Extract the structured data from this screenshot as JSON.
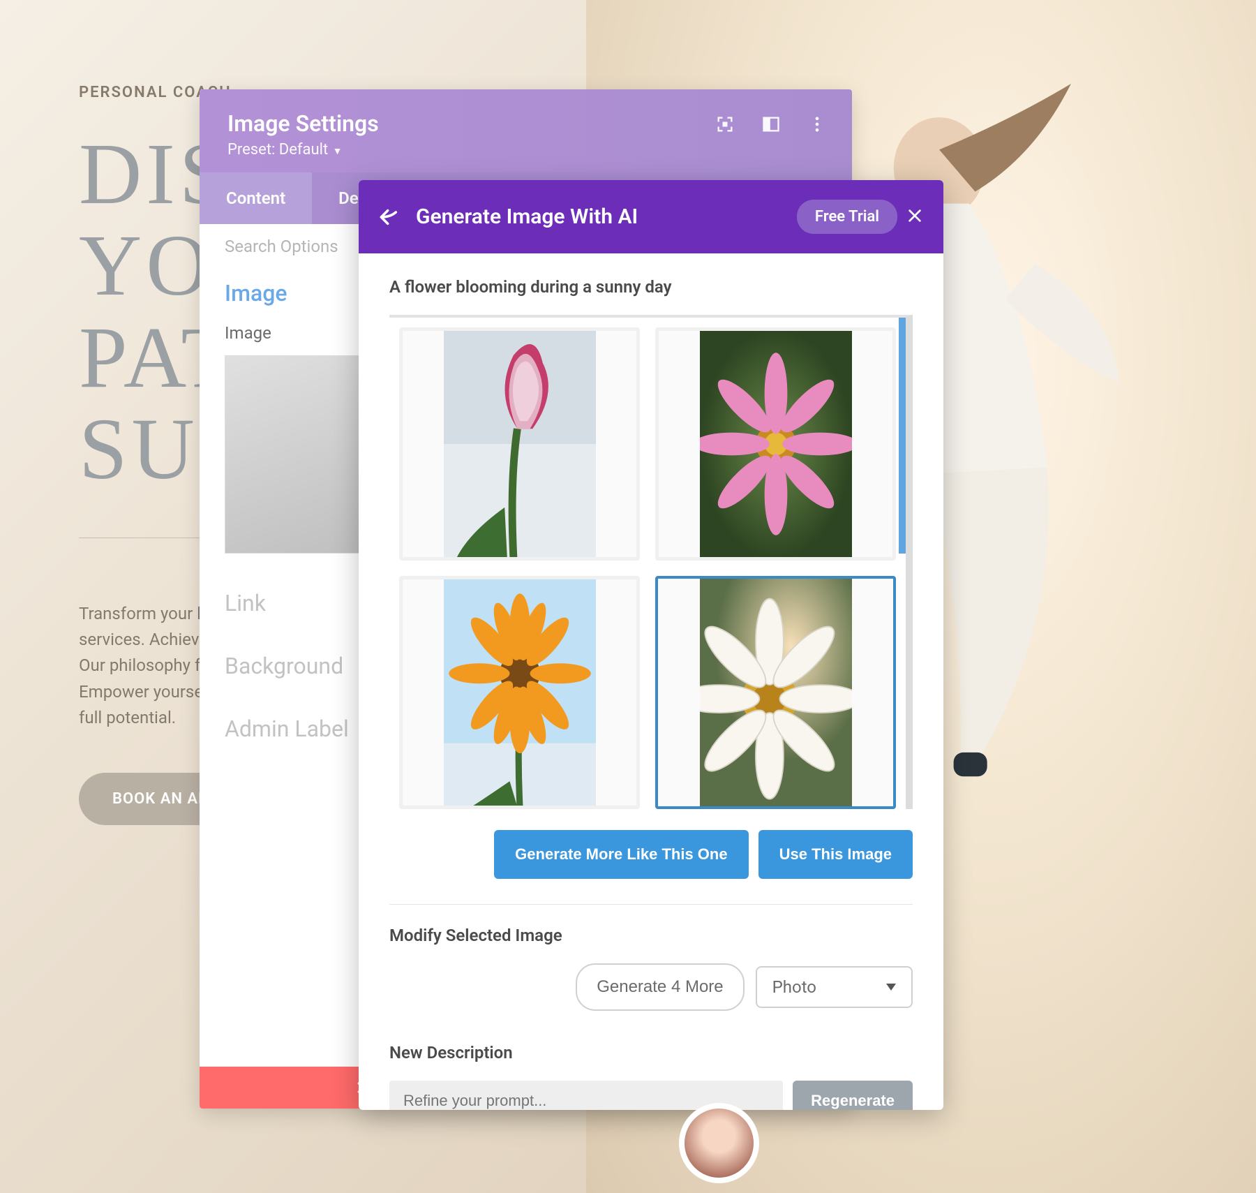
{
  "background": {
    "kicker": "PERSONAL COACH",
    "heading_l1": "DISCOVER",
    "heading_l2": "YOUR PATH TO",
    "heading_l3": "SUCCESS",
    "paragraph": "Transform your life and career with our personalized coaching services. Achieve your goals with a tailored approach that works. Our philosophy focuses on growth, accountability, and life balance. Empower yourself with tools and strategies designed to unlock your full potential.",
    "cta": "BOOK AN APPOINTMENT"
  },
  "settings_panel": {
    "title": "Image Settings",
    "preset_label": "Preset: Default",
    "tabs": [
      "Content",
      "Design"
    ],
    "search_placeholder": "Search Options",
    "section_image": "Image",
    "field_image": "Image",
    "section_link": "Link",
    "section_background": "Background",
    "section_admin": "Admin Label"
  },
  "ai_modal": {
    "title": "Generate Image With AI",
    "trial_label": "Free Trial",
    "prompt": "A flower blooming during a sunny day",
    "btn_more_like": "Generate More Like This One",
    "btn_use": "Use This Image",
    "modify_label": "Modify Selected Image",
    "btn_generate4": "Generate 4 More",
    "select_value": "Photo",
    "new_desc_label": "New Description",
    "refine_placeholder": "Refine your prompt...",
    "btn_regenerate": "Regenerate"
  }
}
